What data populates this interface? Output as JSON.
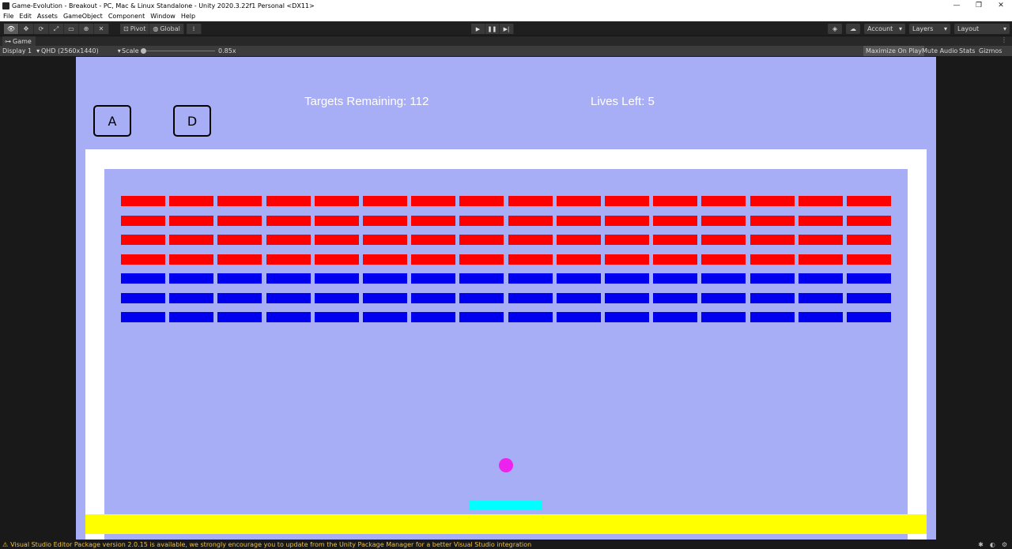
{
  "window": {
    "title": "Game-Evolution - Breakout - PC, Mac & Linux Standalone - Unity 2020.3.22f1 Personal <DX11>"
  },
  "menu": [
    "File",
    "Edit",
    "Assets",
    "GameObject",
    "Component",
    "Window",
    "Help"
  ],
  "toolbar": {
    "pivot_label": "Pivot",
    "global_label": "Global",
    "account_label": "Account",
    "layers_label": "Layers",
    "layout_label": "Layout"
  },
  "game_tab": {
    "label": "Game"
  },
  "game_toolbar": {
    "display": "Display 1",
    "resolution": "QHD (2560x1440)",
    "scale_label": "Scale",
    "scale_value": "0.85x",
    "maximize": "Maximize On Play",
    "mute": "Mute Audio",
    "stats": "Stats",
    "gizmos": "Gizmos"
  },
  "game": {
    "key_left": "A",
    "key_right": "D",
    "targets_text": "Targets Remaining: 112",
    "lives_text": "Lives Left: 5",
    "brick_columns": 16,
    "brick_rows": [
      "red",
      "red",
      "red",
      "red",
      "blue",
      "blue",
      "blue"
    ],
    "colors": {
      "red": "#ff0000",
      "blue": "#0000ee",
      "ball": "#ee22ee",
      "paddle": "#00ffff",
      "floor": "#ffff00",
      "background": "#a8aef6",
      "wall": "#ffffff"
    }
  },
  "status": {
    "message": "Visual Studio Editor Package version 2.0.15 is available, we strongly encourage you to update from the Unity Package Manager for a better Visual Studio integration"
  }
}
